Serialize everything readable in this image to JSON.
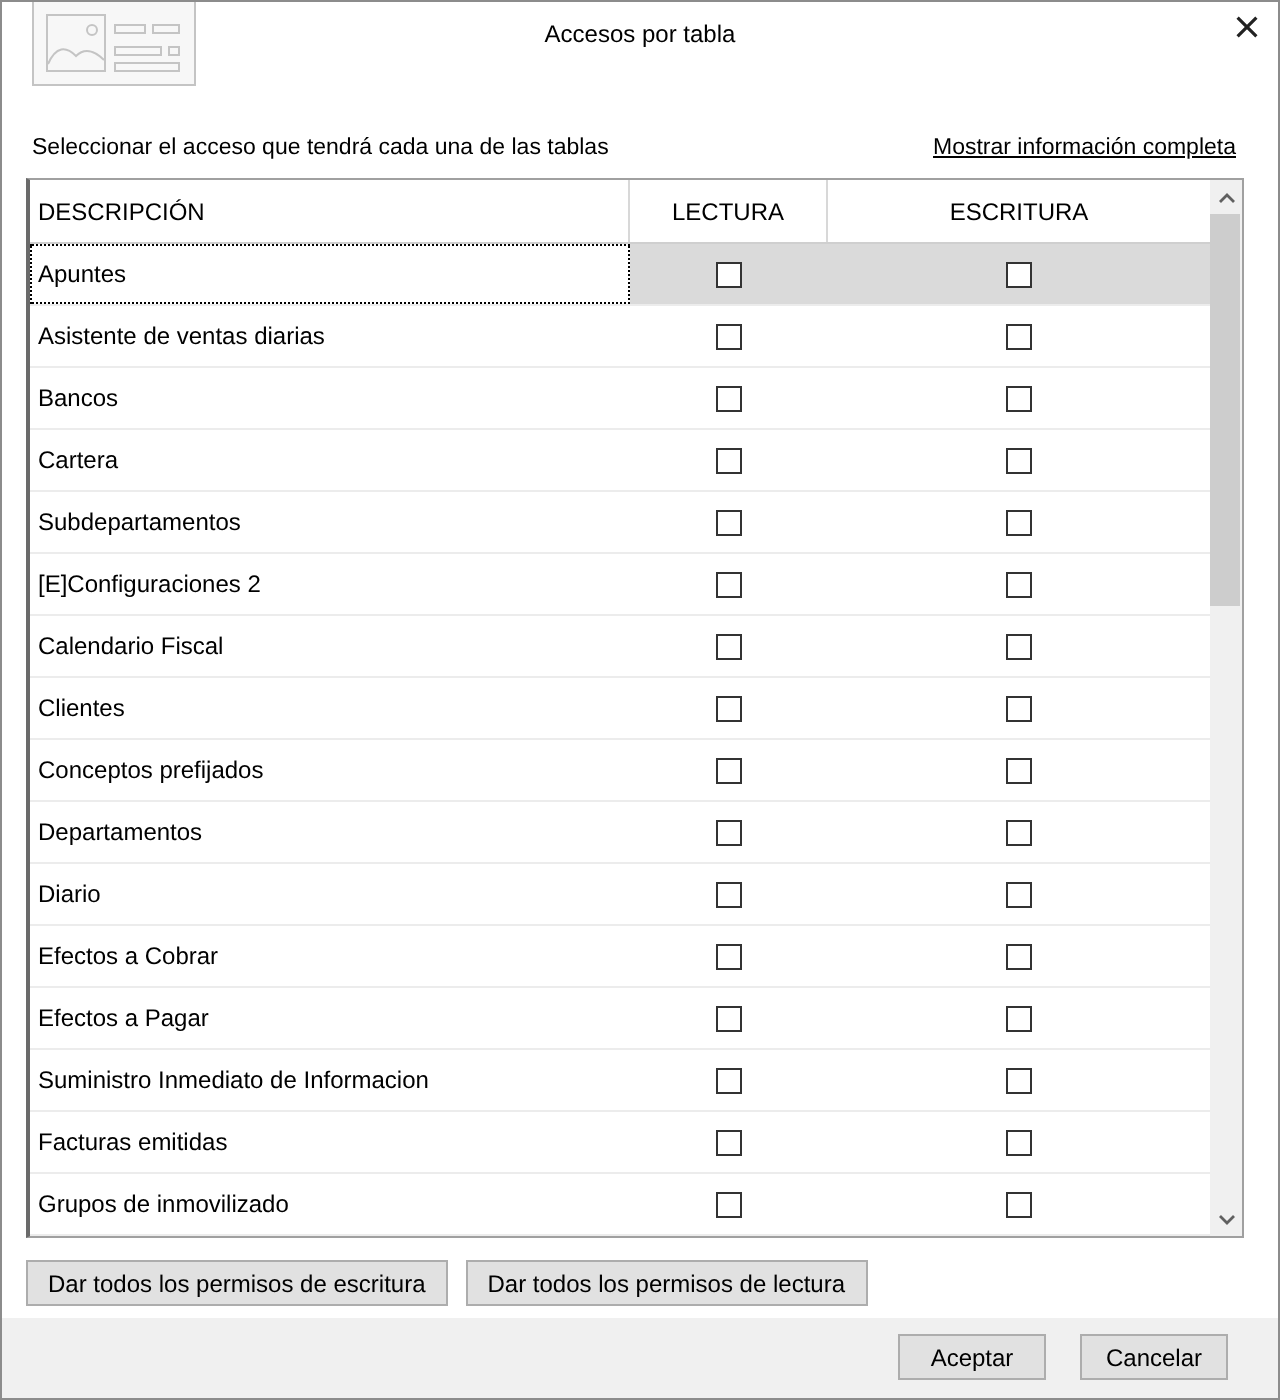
{
  "window": {
    "title": "Accesos por tabla"
  },
  "instruction": "Seleccionar el acceso que tendrá cada una de las tablas",
  "details_link": "Mostrar información completa",
  "table": {
    "columns": [
      "DESCRIPCIÓN",
      "LECTURA",
      "ESCRITURA"
    ],
    "rows": [
      {
        "description": "Apuntes",
        "selected": true,
        "read": false,
        "write": false
      },
      {
        "description": "Asistente de ventas diarias",
        "selected": false,
        "read": false,
        "write": false
      },
      {
        "description": "Bancos",
        "selected": false,
        "read": false,
        "write": false
      },
      {
        "description": "Cartera",
        "selected": false,
        "read": false,
        "write": false
      },
      {
        "description": "Subdepartamentos",
        "selected": false,
        "read": false,
        "write": false
      },
      {
        "description": "[E]Configuraciones 2",
        "selected": false,
        "read": false,
        "write": false
      },
      {
        "description": "Calendario Fiscal",
        "selected": false,
        "read": false,
        "write": false
      },
      {
        "description": "Clientes",
        "selected": false,
        "read": false,
        "write": false
      },
      {
        "description": "Conceptos prefijados",
        "selected": false,
        "read": false,
        "write": false
      },
      {
        "description": "Departamentos",
        "selected": false,
        "read": false,
        "write": false
      },
      {
        "description": "Diario",
        "selected": false,
        "read": false,
        "write": false
      },
      {
        "description": "Efectos a Cobrar",
        "selected": false,
        "read": false,
        "write": false
      },
      {
        "description": "Efectos a Pagar",
        "selected": false,
        "read": false,
        "write": false
      },
      {
        "description": "Suministro Inmediato de Informacion",
        "selected": false,
        "read": false,
        "write": false
      },
      {
        "description": "Facturas emitidas",
        "selected": false,
        "read": false,
        "write": false
      },
      {
        "description": "Grupos de inmovilizado",
        "selected": false,
        "read": false,
        "write": false
      }
    ]
  },
  "grant_buttons": [
    "Dar todos los permisos de escritura",
    "Dar todos los permisos de lectura"
  ],
  "buttons": [
    "Aceptar",
    "Cancelar"
  ]
}
